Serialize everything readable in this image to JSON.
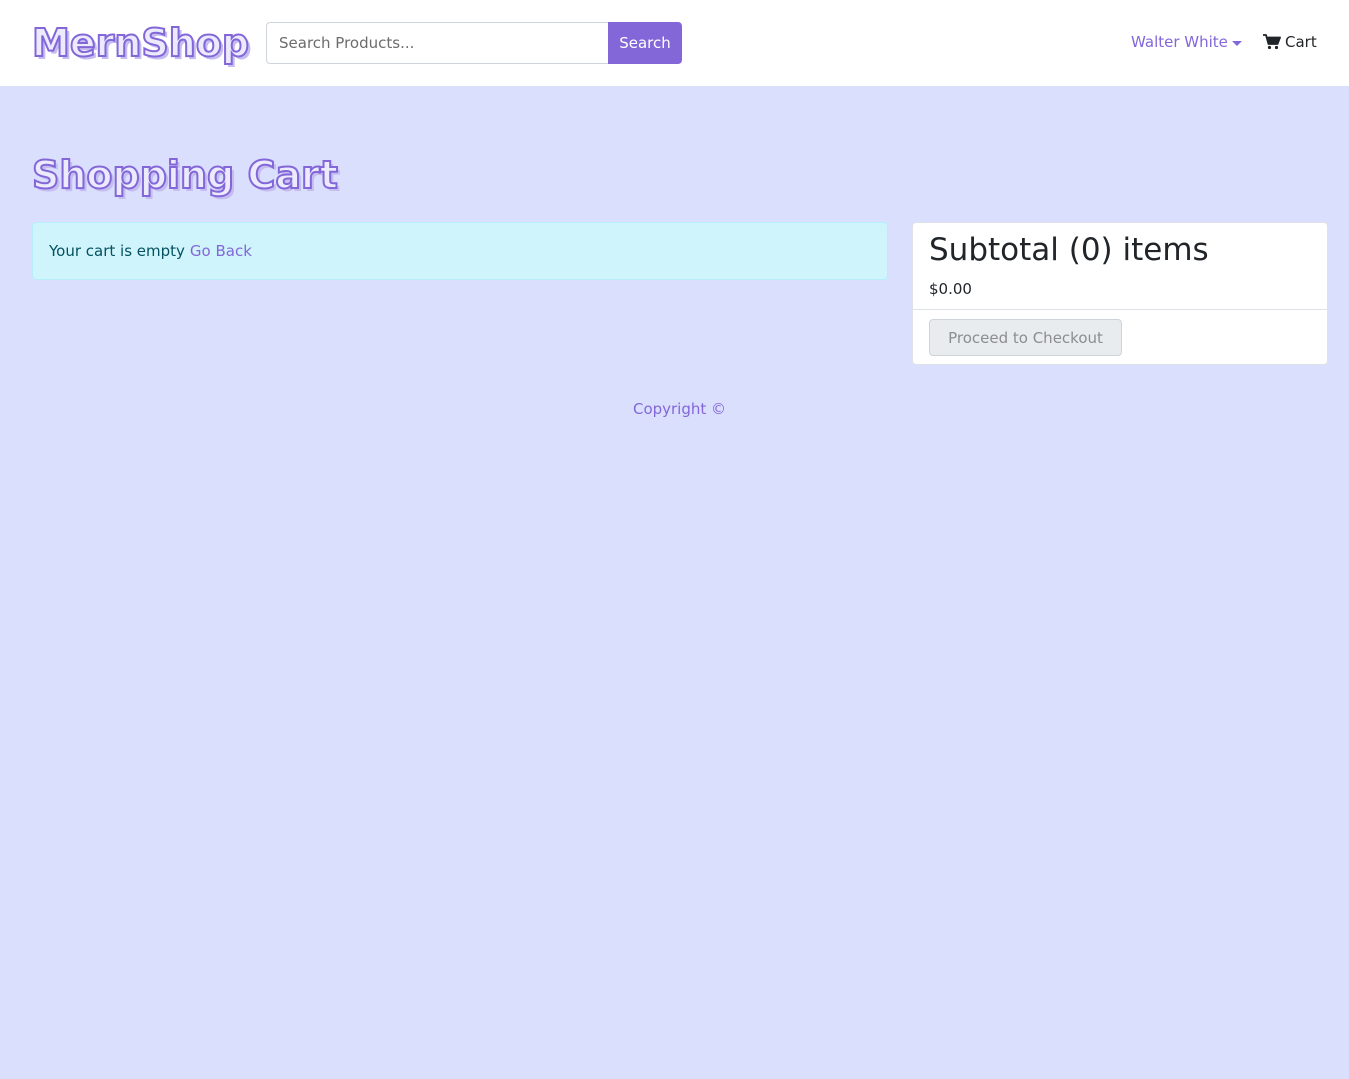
{
  "header": {
    "brand": "MernShop",
    "search": {
      "placeholder": "Search Products...",
      "value": "",
      "button_label": "Search"
    },
    "user_menu_label": "Walter White",
    "cart_label": "Cart",
    "cart_icon": "shopping-cart-icon"
  },
  "main": {
    "title": "Shopping Cart",
    "empty_message": "Your cart is empty",
    "go_back_label": "Go Back",
    "summary": {
      "subtotal_label": "Subtotal (0) items",
      "subtotal_price": "$0.00",
      "checkout_label": "Proceed to Checkout"
    }
  },
  "footer": {
    "copyright": "Copyright ©"
  },
  "colors": {
    "accent": "#8367d8",
    "page_background": "#dadffe",
    "alert_background": "#cff4fc",
    "alert_text": "#055160"
  }
}
